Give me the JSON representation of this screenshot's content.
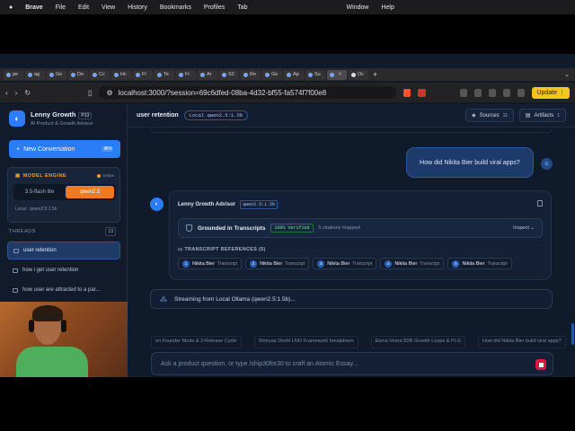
{
  "menubar": {
    "app": "Brave",
    "items": [
      "File",
      "Edit",
      "View",
      "History",
      "Bookmarks",
      "Profiles",
      "Tab",
      "Window",
      "Help"
    ]
  },
  "tabs": [
    "pe",
    "ag",
    "Ge",
    "De",
    "Cc",
    "Hc",
    "Fl",
    "Te",
    "Fr",
    "Ar",
    "SC",
    "Re",
    "Ge",
    "Ap",
    "Su",
    "",
    "Oc"
  ],
  "address": {
    "url": "localhost:3000/?session=69c6dfed-08ba-4d32-bf55-fa574f7f00e8",
    "update_label": "Update"
  },
  "sidebar": {
    "brand": "Lenny Growth",
    "version": "P13",
    "subtitle": "AI Product & Growth Advisor",
    "new_conversation": "New Conversation",
    "new_shortcut": "⌘N",
    "engine": {
      "title": "MODEL ENGINE",
      "status": "Online",
      "options": [
        "3.5-flash lite",
        "qwen2.5"
      ],
      "selected": "qwen2.5",
      "footer": "Local · qwen2.5:1.5b"
    },
    "threads_title": "THREADS",
    "threads_count": "13",
    "threads": [
      {
        "label": "user retention",
        "active": true
      },
      {
        "label": "how i get user retention",
        "active": false
      },
      {
        "label": "how user are attracted to a par...",
        "active": false
      }
    ]
  },
  "header": {
    "title": "user retention",
    "model_chip": "Local qwen2.5:1.5b",
    "sources_label": "Sources",
    "sources_count": "11",
    "artifacts_label": "Artifacts",
    "artifacts_count": "1"
  },
  "conversation": {
    "user_message": "How did Nikita Bier build viral apps?",
    "advisor_name": "Lenny Growth Advisor",
    "advisor_model": "qwen2.5:1.5b",
    "grounded_title": "Grounded in Transcripts",
    "verified_badge": "100% Verified",
    "citations_text": "5 citations mapped",
    "inspect_label": "Inspect",
    "refs_title": "TRANSCRIPT REFERENCES (5)",
    "references": [
      {
        "num": "1",
        "name": "Nikita Bier",
        "type": "Transcript"
      },
      {
        "num": "2",
        "name": "Nikita Bier",
        "type": "Transcript"
      },
      {
        "num": "3",
        "name": "Nikita Bier",
        "type": "Transcript"
      },
      {
        "num": "4",
        "name": "Nikita Bier",
        "type": "Transcript"
      },
      {
        "num": "5",
        "name": "Nikita Bier",
        "type": "Transcript"
      }
    ],
    "streaming_text": "Streaming from Local Ollama (qwen2.5:1.5b)..."
  },
  "suggestions": [
    "on Founder Mode & 2-Release Cycle",
    "Shreyas Doshi LNO Framework breakdown",
    "Elena Verna B2B Growth Loops & PLG",
    "How did Nikita Bier build viral apps?"
  ],
  "composer": {
    "placeholder": "Ask a product question, or type /ship30for30 to craft an Atomic Essay..."
  },
  "colors": {
    "accent": "#2b7cf7",
    "engine_orange": "#f07a22",
    "stop_red": "#e0163b",
    "background": "#0f1a2b"
  }
}
